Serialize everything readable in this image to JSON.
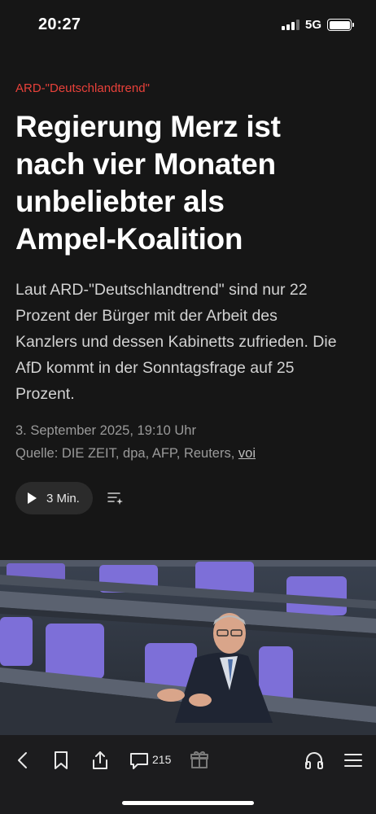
{
  "status_bar": {
    "time": "20:27",
    "network": "5G",
    "signal_bars_active": 3,
    "battery_level": 1.0
  },
  "article": {
    "kicker": "ARD-\"Deutschlandtrend\"",
    "headline_lines": [
      "Regierung Merz ist",
      "nach vier Monaten",
      "unbeliebter als",
      "Ampel-Koalition"
    ],
    "lede_lines": [
      "Laut ARD-\"Deutschlandtrend\" sind nur 22",
      "Prozent der Bürger mit der Arbeit des",
      "Kanzlers und dessen Kabinetts zufrieden. Die",
      "AfD kommt in der Sonntagsfrage auf 25",
      "Prozent."
    ],
    "dateline": "3. September 2025, 19:10 Uhr",
    "source_prefix": "Quelle: DIE ZEIT, dpa, AFP, Reuters, ",
    "source_link": "voi",
    "audio_label": "3 Min."
  },
  "toolbar": {
    "comment_count": "215",
    "icons": [
      "back-icon",
      "bookmark-icon",
      "share-icon",
      "comment-icon",
      "gift-icon",
      "headphones-icon",
      "menu-icon"
    ]
  },
  "colors": {
    "background": "#161616",
    "kicker": "#e8413a",
    "seats": "#7d6fd8",
    "toolbar": "#1c1c1e"
  }
}
